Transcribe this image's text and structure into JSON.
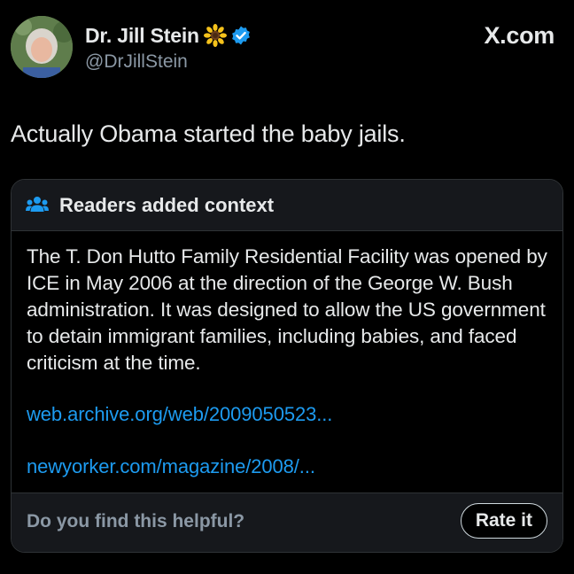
{
  "author": {
    "display_name": "Dr. Jill Stein",
    "handle": "@DrJillStein",
    "avatar_icon": "profile-photo",
    "badge_icons": [
      "sunflower-icon",
      "verified-badge-icon"
    ]
  },
  "brand": {
    "label": "X.com"
  },
  "tweet": {
    "text": "Actually Obama started the baby jails."
  },
  "community_note": {
    "header_icon": "people-icon",
    "title": "Readers added context",
    "body": "The T. Don Hutto Family Residential Facility was opened by ICE in May 2006 at the direction of the George W. Bush administration. It was designed to allow the US government to detain immigrant families, including babies,  and faced criticism at the time.",
    "links": [
      "web.archive.org/web/2009050523...",
      "newyorker.com/magazine/2008/..."
    ],
    "footer": {
      "question": "Do you find this helpful?",
      "rate_button": "Rate it"
    }
  },
  "colors": {
    "background": "#000000",
    "text_primary": "#e7e9ea",
    "text_secondary": "#8b98a5",
    "link": "#1d9bf0",
    "verified": "#1d9bf0",
    "card_border": "#2f3336",
    "card_header_bg": "#16181c"
  }
}
